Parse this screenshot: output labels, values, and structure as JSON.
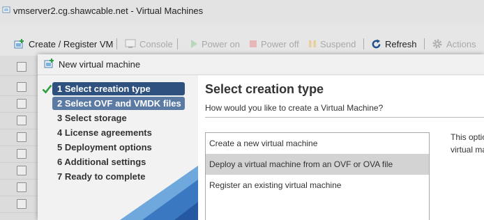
{
  "app": {
    "title": "vmserver2.cg.shawcable.net - Virtual Machines"
  },
  "toolbar": {
    "create": "Create / Register VM",
    "console": "Console",
    "power_on": "Power on",
    "power_off": "Power off",
    "suspend": "Suspend",
    "refresh": "Refresh",
    "actions": "Actions"
  },
  "modal": {
    "title": "New virtual machine"
  },
  "wizard": {
    "steps": [
      {
        "label": "1  Select creation type",
        "state": "current",
        "completed": true
      },
      {
        "label": "2  Select OVF and VMDK files",
        "state": "next"
      },
      {
        "label": "3  Select storage",
        "state": "pending"
      },
      {
        "label": "4  License agreements",
        "state": "pending"
      },
      {
        "label": "5  Deployment options",
        "state": "pending"
      },
      {
        "label": "6  Additional settings",
        "state": "pending"
      },
      {
        "label": "7  Ready to complete",
        "state": "pending"
      }
    ]
  },
  "content": {
    "title": "Select creation type",
    "subtitle": "How would you like to create a Virtual Machine?",
    "options": [
      {
        "label": "Create a new virtual machine",
        "selected": false
      },
      {
        "label": "Deploy a virtual machine from an OVF or OVA file",
        "selected": true
      },
      {
        "label": "Register an existing virtual machine",
        "selected": false
      }
    ],
    "description_line1": "This optio",
    "description_line2": "virtual ma"
  },
  "colors": {
    "step_current_bg": "#2e5180",
    "step_next_bg": "#5b7aa4",
    "check": "#2e9e3e",
    "refresh_icon": "#1f4e8c"
  }
}
